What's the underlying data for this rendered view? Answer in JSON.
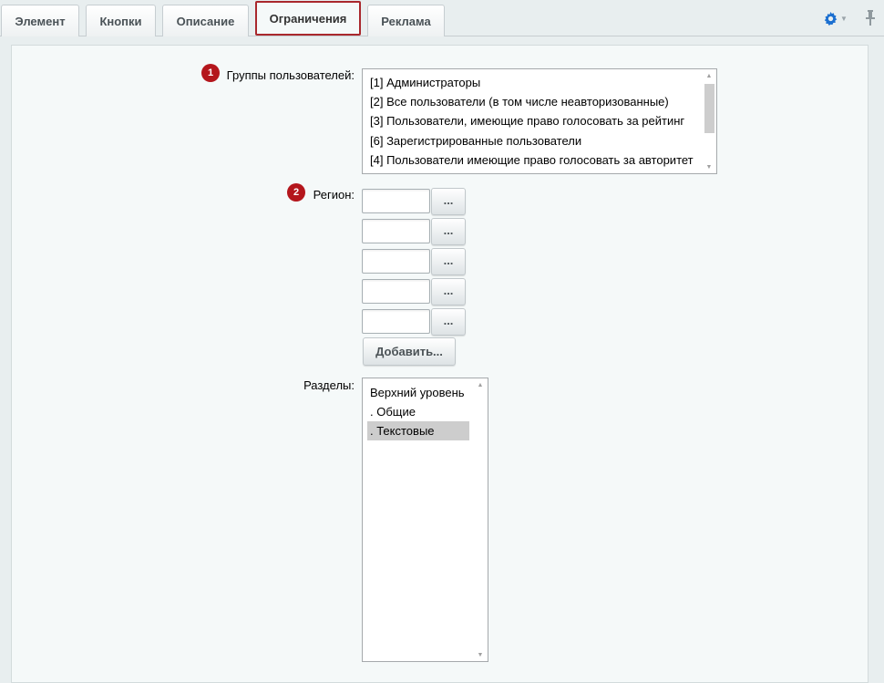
{
  "tabs": [
    {
      "label": "Элемент"
    },
    {
      "label": "Кнопки"
    },
    {
      "label": "Описание"
    },
    {
      "label": "Ограничения",
      "active": true
    },
    {
      "label": "Реклама"
    }
  ],
  "toolbar": {
    "gear_icon": "gear-icon",
    "pin_icon": "pin-icon"
  },
  "groups": {
    "badge": "1",
    "label": "Группы пользователей:",
    "options": [
      "[1] Администраторы",
      "[2] Все пользователи (в том числе неавторизованные)",
      "[3] Пользователи, имеющие право голосовать за рейтинг",
      "[6] Зарегистрированные пользователи",
      "[4] Пользователи имеющие право голосовать за авторитет"
    ]
  },
  "region": {
    "badge": "2",
    "label": "Регион:",
    "inputs": [
      "",
      "",
      "",
      "",
      ""
    ],
    "browse_label": "...",
    "add_label": "Добавить..."
  },
  "sections": {
    "label": "Разделы:",
    "options": [
      "Верхний уровень",
      ". Общие",
      ". Текстовые"
    ],
    "selected_index": 2
  },
  "colors": {
    "badge": "#b4161c",
    "active_tab_border": "#a9282d",
    "background": "#e8eeef",
    "panel": "#f5f9f9"
  }
}
